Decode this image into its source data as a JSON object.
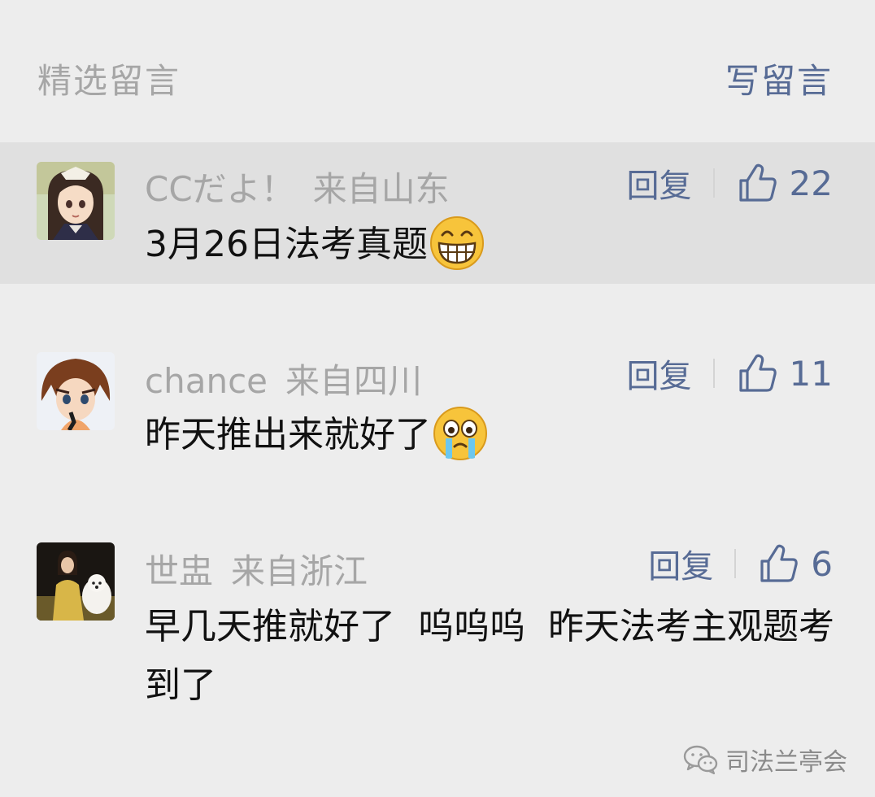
{
  "header": {
    "title": "精选留言",
    "write_label": "写留言"
  },
  "comments": [
    {
      "username": "CCだよ！",
      "location": "来自山东",
      "reply_label": "回复",
      "likes": "22",
      "text": "3月26日法考真题",
      "emoji": "grinning-face-icon"
    },
    {
      "username": "chance",
      "location": "来自四川",
      "reply_label": "回复",
      "likes": "11",
      "text": "昨天推出来就好了",
      "emoji": "crying-face-icon"
    },
    {
      "username": "世盅",
      "location": "来自浙江",
      "reply_label": "回复",
      "likes": "6",
      "text": "早几天推就好了  呜呜呜  昨天法考主观题考到了"
    }
  ],
  "watermark": {
    "text": "司法兰亭会",
    "icon": "wechat-icon"
  },
  "colors": {
    "background": "#ededed",
    "highlight_row": "#e0e0e0",
    "link": "#576b95",
    "muted": "#a6a6a6",
    "text": "#111111"
  }
}
